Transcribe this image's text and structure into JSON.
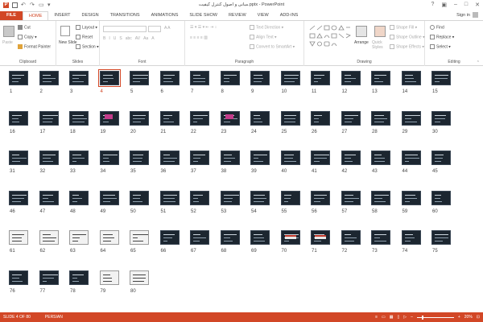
{
  "app": {
    "title": "مبانی و اصول کنترل کیفیت.pptx - PowerPoint",
    "signin": "Sign in"
  },
  "tabs": [
    "FILE",
    "HOME",
    "INSERT",
    "DESIGN",
    "TRANSITIONS",
    "ANIMATIONS",
    "SLIDE SHOW",
    "REVIEW",
    "VIEW",
    "ADD-INS"
  ],
  "active_tab": "HOME",
  "ribbon": {
    "clipboard": {
      "paste": "Paste",
      "cut": "Cut",
      "copy": "Copy",
      "format_painter": "Format Painter",
      "label": "Clipboard"
    },
    "slides": {
      "new_slide": "New Slide",
      "layout": "Layout",
      "reset": "Reset",
      "section": "Section",
      "label": "Slides"
    },
    "font": {
      "label": "Font",
      "buttons": [
        "B",
        "I",
        "U",
        "S",
        "abc",
        "AV",
        "Aa",
        "A"
      ]
    },
    "paragraph": {
      "text_direction": "Text Direction",
      "align_text": "Align Text",
      "convert_smartart": "Convert to SmartArt",
      "label": "Paragraph"
    },
    "drawing": {
      "arrange": "Arrange",
      "quick_styles": "Quick Styles",
      "shape_fill": "Shape Fill",
      "shape_outline": "Shape Outline",
      "shape_effects": "Shape Effects",
      "label": "Drawing"
    },
    "editing": {
      "find": "Find",
      "replace": "Replace",
      "select": "Select",
      "label": "Editing"
    }
  },
  "slides": {
    "total": 80,
    "selected": 4,
    "pink_slides": [
      19,
      23
    ],
    "callout_slides": [
      70,
      71
    ],
    "light_slides": [
      61,
      62,
      63,
      64,
      65,
      79,
      80
    ]
  },
  "status": {
    "slide_indicator": "SLIDE 4 OF 80",
    "language": "PERSIAN",
    "zoom": "20%"
  },
  "colors": {
    "accent": "#d24726",
    "slide_bg": "#1c2630"
  }
}
